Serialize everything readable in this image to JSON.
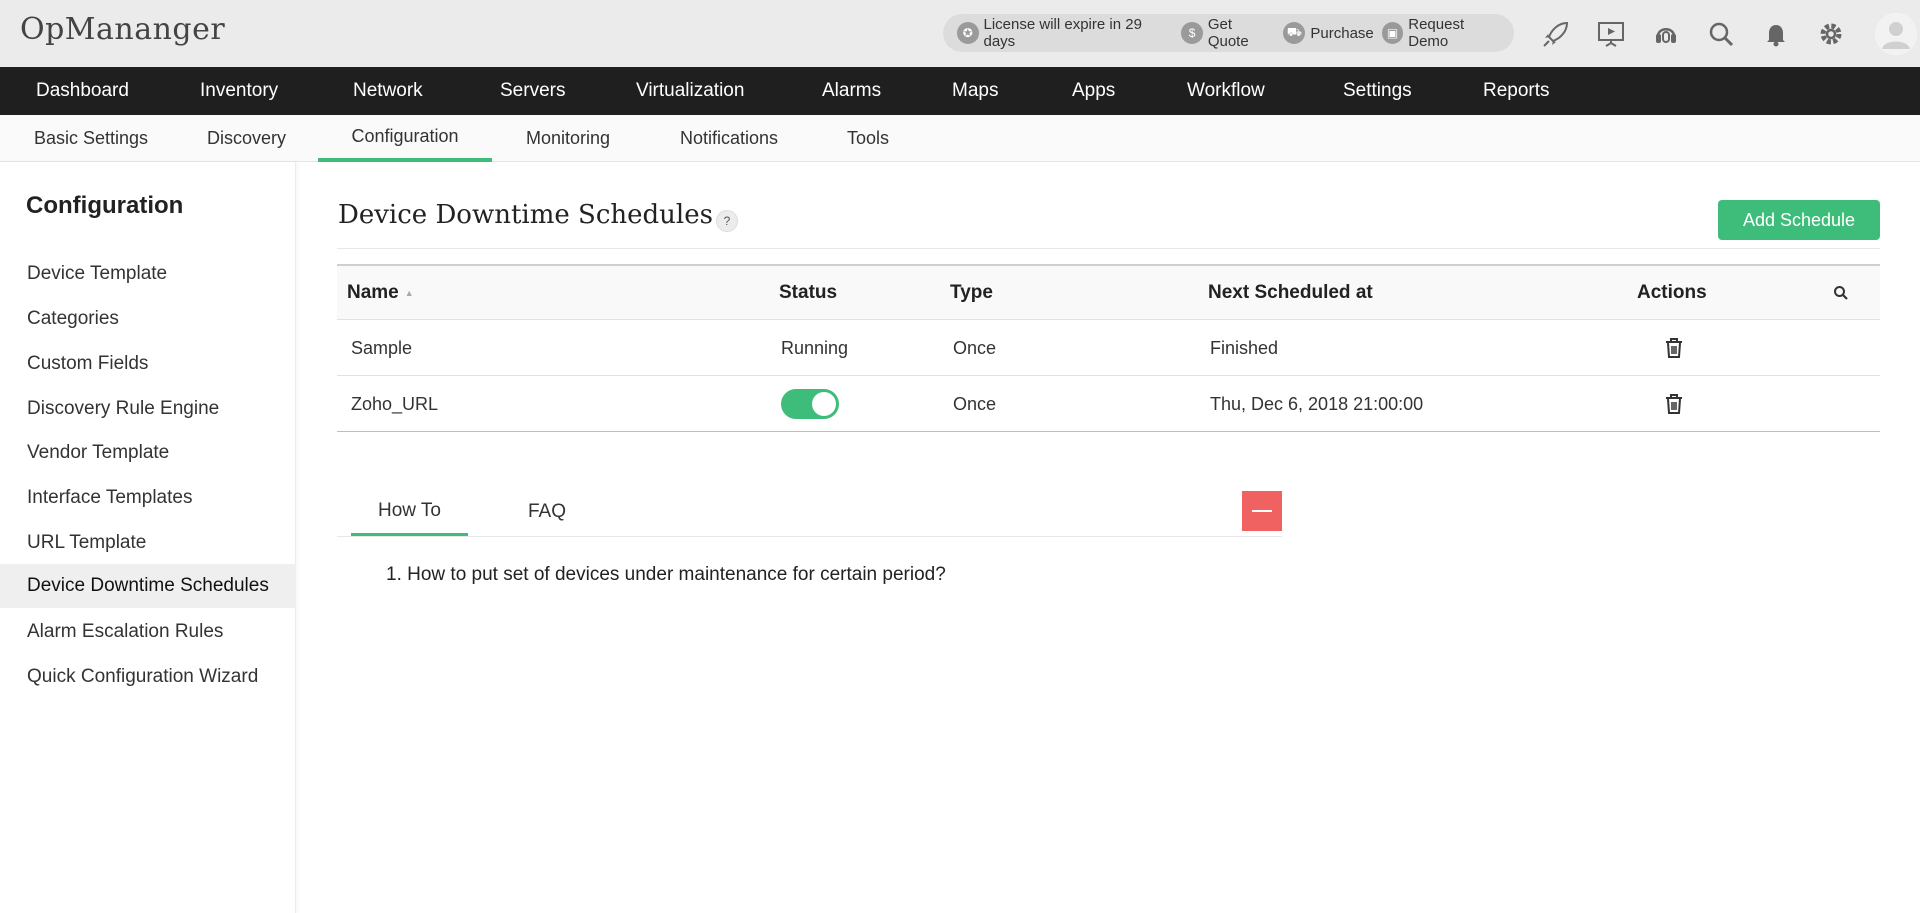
{
  "app": {
    "title": "OpMananger"
  },
  "header": {
    "license_text": "License will expire in 29 days",
    "get_quote": "Get Quote",
    "purchase": "Purchase",
    "request_demo": "Request Demo"
  },
  "main_nav": [
    "Dashboard",
    "Inventory",
    "Network",
    "Servers",
    "Virtualization",
    "Alarms",
    "Maps",
    "Apps",
    "Workflow",
    "Settings",
    "Reports"
  ],
  "sub_nav": [
    "Basic Settings",
    "Discovery",
    "Configuration",
    "Monitoring",
    "Notifications",
    "Tools"
  ],
  "sidebar": {
    "title": "Configuration",
    "items": [
      "Device Template",
      "Categories",
      "Custom Fields",
      "Discovery Rule Engine",
      "Vendor Template",
      "Interface Templates",
      "URL Template",
      "Device Downtime Schedules",
      "Alarm Escalation Rules",
      "Quick Configuration Wizard"
    ]
  },
  "page": {
    "title": "Device Downtime Schedules",
    "help": "?",
    "add_button": "Add Schedule"
  },
  "table": {
    "columns": [
      "Name",
      "Status",
      "Type",
      "Next Scheduled at",
      "Actions"
    ],
    "rows": [
      {
        "name": "Sample",
        "status": "Running",
        "type": "Once",
        "next": "Finished"
      },
      {
        "name": "Zoho_URL",
        "status": "",
        "type": "Once",
        "next": "Thu, Dec 6, 2018 21:00:00"
      }
    ]
  },
  "help_tabs": {
    "tabs": [
      "How To",
      "FAQ"
    ],
    "howto_items": [
      "1. How to put set of devices under maintenance for certain period?"
    ]
  },
  "colors": {
    "accent": "#3ebd7a",
    "nav_bg": "#1f1f1f",
    "collapse": "#f06262"
  }
}
